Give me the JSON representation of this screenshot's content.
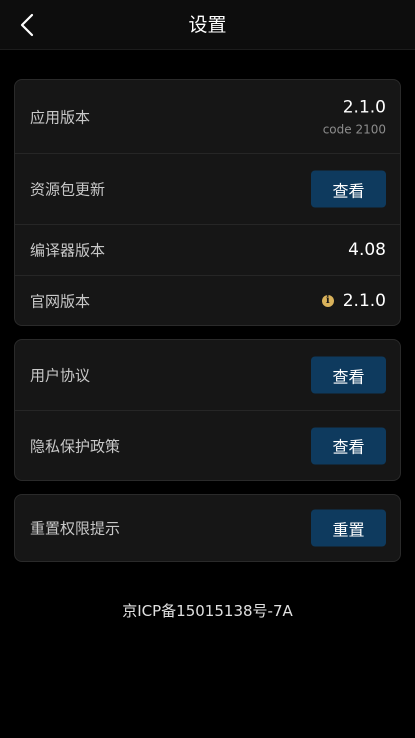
{
  "header": {
    "title": "设置"
  },
  "version_card": {
    "app_version": {
      "label": "应用版本",
      "value": "2.1.0",
      "code": "code 2100"
    },
    "resource_update": {
      "label": "资源包更新",
      "button": "查看"
    },
    "compiler_version": {
      "label": "编译器版本",
      "value": "4.08"
    },
    "website_version": {
      "label": "官网版本",
      "value": "2.1.0"
    }
  },
  "policy_card": {
    "user_agreement": {
      "label": "用户协议",
      "button": "查看"
    },
    "privacy_policy": {
      "label": "隐私保护政策",
      "button": "查看"
    }
  },
  "permission_card": {
    "reset_permission": {
      "label": "重置权限提示",
      "button": "重置"
    }
  },
  "footer": {
    "icp": "京ICP备15015138号-7A"
  },
  "colors": {
    "background": "#000000",
    "card": "#161616",
    "button": "#0e3a5e",
    "info_icon": "#d9b25b"
  }
}
